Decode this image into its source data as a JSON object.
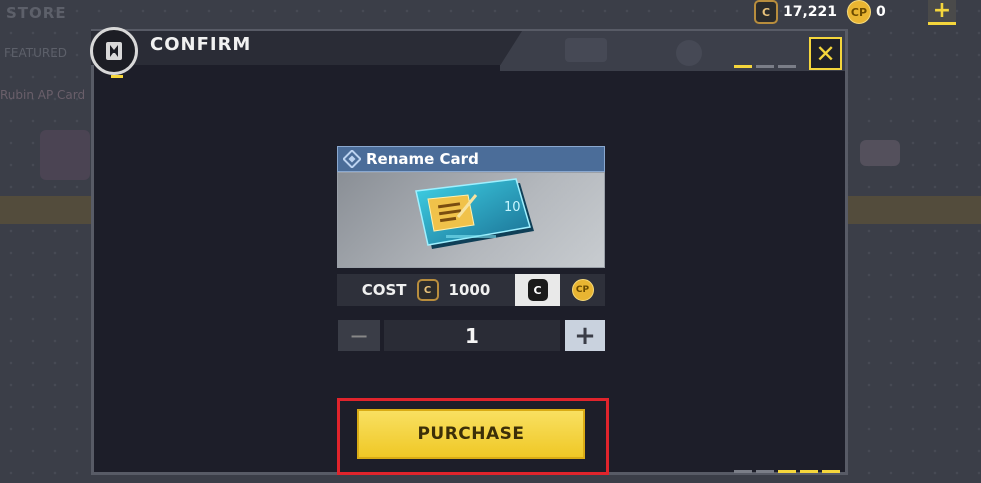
{
  "background": {
    "store_label": "STORE",
    "featured_label": "FEATURED",
    "item_label": "Rubin AP Card"
  },
  "topbar": {
    "cod_points": "17,221",
    "cp_points": "0",
    "cod_icon": "C",
    "cp_icon": "CP",
    "add_label": "+"
  },
  "dialog": {
    "title": "CONFIRM",
    "close_label": "✕",
    "item": {
      "name": "Rename Card",
      "card_number": "10"
    },
    "cost": {
      "label": "COST",
      "amount": "1000",
      "currency_icon": "C"
    },
    "currency_toggle": {
      "cod_label": "C",
      "cp_label": "CP",
      "selected": "cod"
    },
    "quantity": {
      "minus": "−",
      "value": "1",
      "plus": "+"
    },
    "purchase_label": "PURCHASE"
  },
  "colors": {
    "accent_yellow": "#f5d63c",
    "dialog_bg": "#1d1e29",
    "highlight_red": "#e0242c",
    "header_blue": "#4b6d99"
  }
}
